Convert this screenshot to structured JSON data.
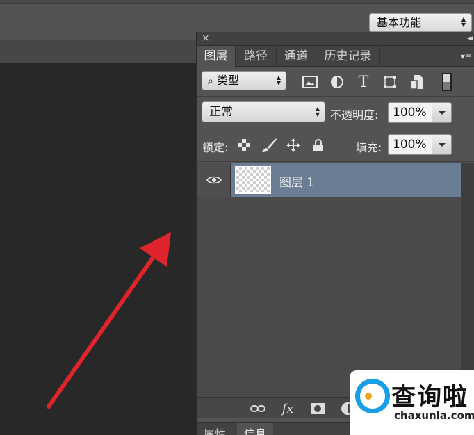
{
  "workspace": {
    "label": "基本功能"
  },
  "panel": {
    "tabs": [
      "图层",
      "路径",
      "通道",
      "历史记录"
    ],
    "filter": {
      "kind_label": "类型",
      "icons": [
        "image-filter-icon",
        "adjustment-filter-icon",
        "type-filter-icon",
        "shape-filter-icon",
        "smart-object-filter-icon"
      ]
    },
    "blend_mode": "正常",
    "opacity_label": "不透明度:",
    "opacity_value": "100%",
    "lock_label": "锁定:",
    "fill_label": "填充:",
    "fill_value": "100%",
    "layers": [
      {
        "name": "图层 1",
        "visible": true,
        "selected": true
      }
    ],
    "bottom_icons": [
      "link-icon",
      "fx-icon",
      "mask-icon",
      "adjustment-icon"
    ],
    "fx_label": "fx"
  },
  "lower_panel": {
    "tabs": [
      "属性",
      "信息"
    ]
  },
  "watermark": {
    "title": "查询啦",
    "url": "chaxunla.com"
  },
  "colors": {
    "arrow": "#e0242c",
    "selection": "#6a7d94",
    "watermark_blue": "#1a9ee8"
  }
}
